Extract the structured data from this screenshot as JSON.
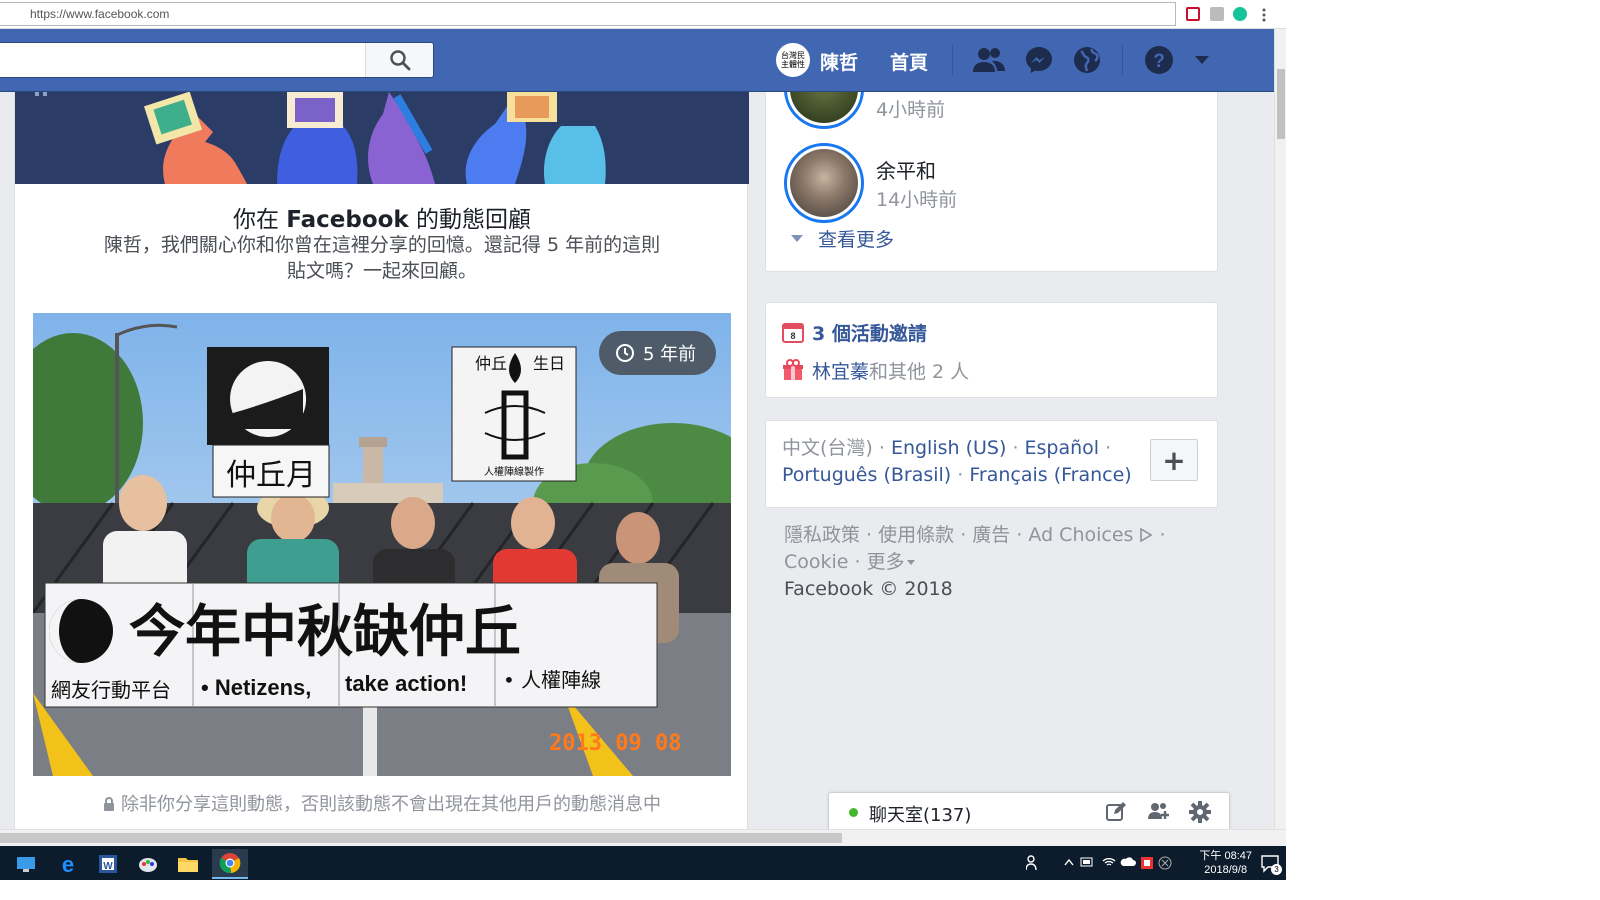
{
  "browser": {
    "url": "https://www.facebook.com"
  },
  "topbar": {
    "search_placeholder": "",
    "avatar_text": "台灣民主體性",
    "username": "陳哲",
    "home": "首頁"
  },
  "memory": {
    "title_prefix": "你在 ",
    "title_brand": "Facebook",
    "title_suffix": " 的動態回顧",
    "subtitle": "陳哲，我們關心你和你曾在這裡分享的回憶。還記得 5 年前的這則貼文嗎？一起來回顧。",
    "time_badge": "5 年前",
    "photo": {
      "sign_left": "仲丘月",
      "sign_right_title_l": "仲丘",
      "sign_right_title_r": "生日",
      "sign_right_footer": "人權陣線製作",
      "banner_text": "今年中秋缺仲丘",
      "banner_sub_1": "網友行動平台",
      "banner_sub_2": "• Netizens,",
      "banner_sub_3": "take action!",
      "banner_sub_4": "• 人權陣線",
      "date_stamp": "2013 09 08"
    },
    "privacy_note": "除非你分享這則動態，否則該動態不會出現在其他用戶的動態消息中"
  },
  "stories": {
    "items": [
      {
        "name": "",
        "time": "4小時前"
      },
      {
        "name": "余平和",
        "time": "14小時前"
      }
    ],
    "see_more": "查看更多"
  },
  "events": {
    "invites": "3 個活動邀請",
    "birthday_name": "林宜蓁",
    "birthday_rest": "和其他 2 人"
  },
  "languages": {
    "current": "中文(台灣)",
    "list": [
      "English (US)",
      "Español",
      "Português (Brasil)",
      "Français (France)"
    ],
    "sep": " · "
  },
  "footer": {
    "privacy": "隱私政策",
    "terms": "使用條款",
    "ads": "廣告",
    "adchoices": "Ad Choices",
    "cookie": "Cookie",
    "more": "更多",
    "copyright": "Facebook © 2018"
  },
  "chat": {
    "label": "聊天室(137)"
  },
  "taskbar": {
    "time": "下午 08:47",
    "date": "2018/9/8",
    "notif_count": "3"
  },
  "colors": {
    "fb_blue": "#4267b2",
    "link": "#365899",
    "online": "#42b72a"
  }
}
